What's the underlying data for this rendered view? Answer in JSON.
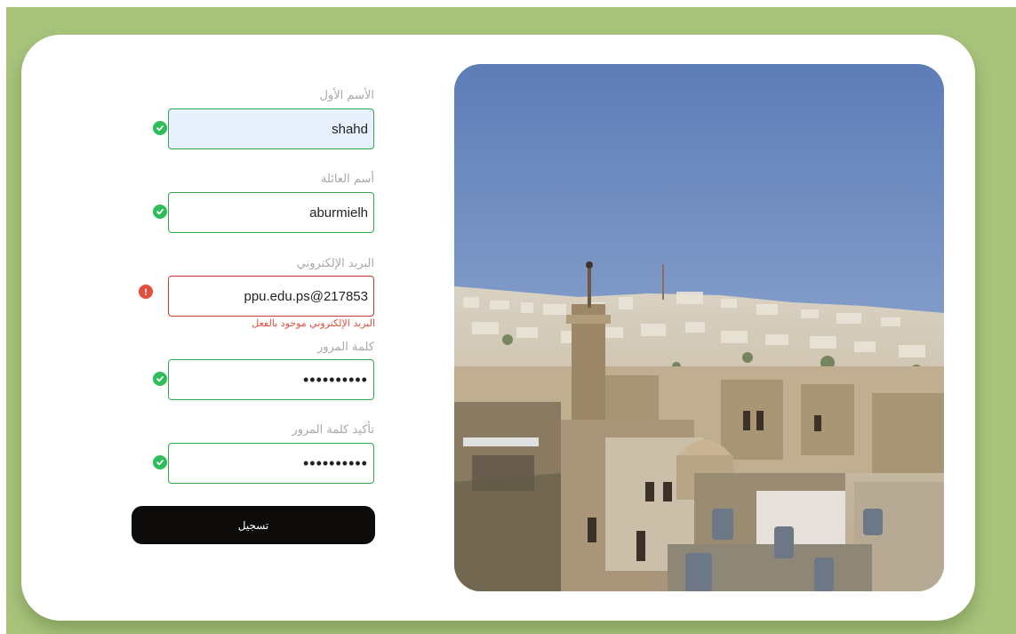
{
  "form": {
    "first_name": {
      "label": "الأسم الأول",
      "value": "shahd",
      "status": "valid"
    },
    "last_name": {
      "label": "أسم العائلة",
      "value": "aburmielh",
      "status": "valid"
    },
    "email": {
      "label": "البريد الإلكتروني",
      "value": "ppu.edu.ps@217853",
      "status": "error",
      "error_message": "البريد الإلكتروني موجود بالفعل"
    },
    "password": {
      "label": "كلمة المرور",
      "value": "••••••••••",
      "status": "valid"
    },
    "confirm_password": {
      "label": "تأكيد كلمة المرور",
      "value": "••••••••••",
      "status": "valid"
    },
    "submit_label": "تسجيل"
  },
  "colors": {
    "page_background": "#a8c47b",
    "valid": "#2fa84f",
    "error": "#c0392b",
    "button": "#0e0b0b"
  },
  "icons": {
    "valid": "check-circle-icon",
    "error": "exclamation-circle-icon"
  }
}
